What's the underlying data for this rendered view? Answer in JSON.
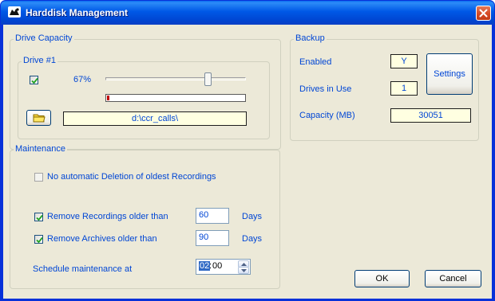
{
  "window": {
    "title": "Harddisk Management"
  },
  "drive_capacity": {
    "legend": "Drive Capacity",
    "drive": {
      "legend": "Drive #1",
      "enabled": true,
      "percent_label": "67%",
      "slider_level_fraction": 0.73,
      "usage_fraction": 0.02,
      "path": "d:\\ccr_calls\\"
    }
  },
  "backup": {
    "legend": "Backup",
    "enabled_label": "Enabled",
    "enabled_value": "Y",
    "drives_in_use_label": "Drives in Use",
    "drives_in_use_value": "1",
    "capacity_label": "Capacity (MB)",
    "capacity_value": "30051",
    "settings_label": "Settings"
  },
  "maintenance": {
    "legend": "Maintenance",
    "no_auto_delete_label": "No automatic Deletion of oldest Recordings",
    "no_auto_delete_checked": false,
    "remove_recordings_label": "Remove Recordings older than",
    "remove_recordings_checked": true,
    "remove_recordings_value": "60",
    "remove_archives_label": "Remove Archives older than",
    "remove_archives_checked": true,
    "remove_archives_value": "90",
    "days_label": "Days",
    "schedule_label": "Schedule maintenance at",
    "schedule_hour": "02",
    "schedule_separator": ":",
    "schedule_minute": "00"
  },
  "buttons": {
    "ok": "OK",
    "cancel": "Cancel"
  },
  "colors": {
    "label_blue": "#0046d5",
    "title_blue": "#0058e6",
    "field_yellow": "#ffffe1",
    "usage_red": "#c00000"
  },
  "icons": {
    "title": "app-icon",
    "close": "close-icon",
    "browse": "folder-icon"
  }
}
